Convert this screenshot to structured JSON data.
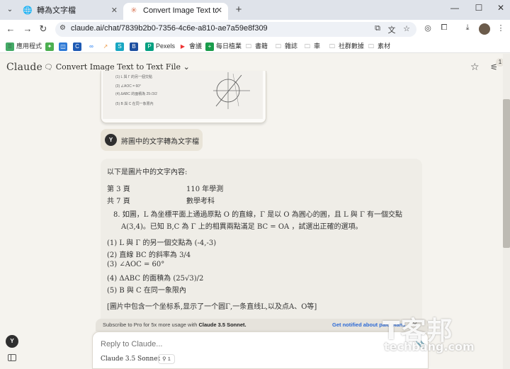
{
  "browser": {
    "tabs": [
      {
        "title": "轉為文字檔",
        "favicon": "globe-icon"
      },
      {
        "title": "Convert Image Text to Text File",
        "favicon": "claude-icon",
        "active": true
      }
    ],
    "url": "claude.ai/chat/7839b2b0-7356-4c6e-a810-ae7a59e8f309",
    "bookmarks": [
      "應用程式",
      "Pexels",
      "會議",
      "每日植業",
      "書籍",
      "雜誌",
      "車",
      "社群數據",
      "素材"
    ]
  },
  "app": {
    "logo": "Claude",
    "conversation_title": "Convert Image Text to Text File",
    "filter_count": "1"
  },
  "image_card": {
    "lines": [
      "(1) L 與 Γ 的另一個交點",
      "(3) ∠AOC = 60°",
      "(4) ΔABC 的面積為 25√3/2",
      "(5) B 與 C 在同一象限內"
    ]
  },
  "user_message": {
    "avatar": "Y",
    "text": "將圖中的文字轉為文字檔"
  },
  "reply": {
    "intro": "以下是圖片中的文字內容:",
    "page": "第 3 頁",
    "year": "110 年學測",
    "total": "共 7 頁",
    "subject": "數學考科",
    "q_line1": "8. 如圖，L 為坐標平面上通過原點 O 的直線，Γ 是以 O 為圓心的圓，且 L 與 Γ 有一個交點",
    "q_line2": "A(3,4)。已知 B,C 為 Γ 上的相異兩點滿足 BC = OA ，試選出正確的選項。",
    "options": [
      "(1) L 與 Γ 的另一個交點為 (-4,-3)",
      "(2) 直線 BC 的斜率為 3/4",
      "(3) ∠AOC = 60°",
      "(4) ΔABC 的面積為 (25√3)/2",
      "(5) B 與 C 在同一象限內"
    ],
    "note": "[圖片中包含一个坐标系,显示了一个圆Γ,一条直线L,以及点A、O等]"
  },
  "banner": {
    "text_prefix": "Subscribe to Pro for 5x more usage with ",
    "text_bold": "Claude 3.5 Sonnet.",
    "link": "Get notified about paid plans"
  },
  "composer": {
    "placeholder": "Reply to Claude...",
    "model": "Claude 3.5 Sonnet",
    "chip": "1"
  },
  "sidebar": {
    "avatar": "Y"
  },
  "watermark": {
    "big": "T客邦",
    "small": "techbang.com"
  }
}
